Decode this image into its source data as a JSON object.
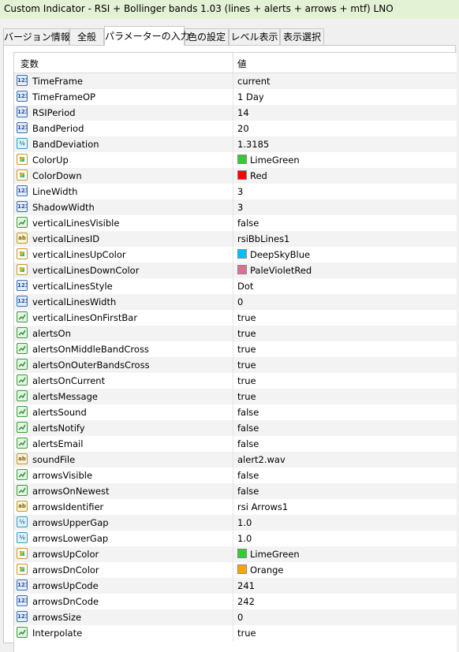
{
  "window": {
    "title": "Custom Indicator - RSI + Bollinger bands 1.03 (lines + alerts + arrows + mtf) LNO"
  },
  "tabs": [
    {
      "label": "バージョン情報",
      "active": false
    },
    {
      "label": "全般",
      "active": false
    },
    {
      "label": "パラメーターの入力",
      "active": true
    },
    {
      "label": "色の設定",
      "active": false
    },
    {
      "label": "レベル表示",
      "active": false
    },
    {
      "label": "表示選択",
      "active": false
    }
  ],
  "grid": {
    "headers": {
      "variable": "変数",
      "value": "値"
    },
    "rows": [
      {
        "name": "TimeFrame",
        "value": "current",
        "type": "int"
      },
      {
        "name": "TimeFrameOP",
        "value": "1 Day",
        "type": "int"
      },
      {
        "name": "RSIPeriod",
        "value": "14",
        "type": "int"
      },
      {
        "name": "BandPeriod",
        "value": "20",
        "type": "int"
      },
      {
        "name": "BandDeviation",
        "value": "1.3185",
        "type": "double"
      },
      {
        "name": "ColorUp",
        "value": "LimeGreen",
        "type": "color",
        "color": "#32cd32"
      },
      {
        "name": "ColorDown",
        "value": "Red",
        "type": "color",
        "color": "#ff0000"
      },
      {
        "name": "LineWidth",
        "value": "3",
        "type": "int"
      },
      {
        "name": "ShadowWidth",
        "value": "3",
        "type": "int"
      },
      {
        "name": "verticalLinesVisible",
        "value": "false",
        "type": "bool"
      },
      {
        "name": "verticalLinesID",
        "value": "rsiBbLines1",
        "type": "string"
      },
      {
        "name": "verticalLinesUpColor",
        "value": "DeepSkyBlue",
        "type": "color",
        "color": "#00bfff"
      },
      {
        "name": "verticalLinesDownColor",
        "value": "PaleVioletRed",
        "type": "color",
        "color": "#db7093"
      },
      {
        "name": "verticalLinesStyle",
        "value": "Dot",
        "type": "int"
      },
      {
        "name": "verticalLinesWidth",
        "value": "0",
        "type": "int"
      },
      {
        "name": "verticalLinesOnFirstBar",
        "value": "true",
        "type": "bool"
      },
      {
        "name": "alertsOn",
        "value": "true",
        "type": "bool"
      },
      {
        "name": "alertsOnMiddleBandCross",
        "value": "true",
        "type": "bool"
      },
      {
        "name": "alertsOnOuterBandsCross",
        "value": "true",
        "type": "bool"
      },
      {
        "name": "alertsOnCurrent",
        "value": "true",
        "type": "bool"
      },
      {
        "name": "alertsMessage",
        "value": "true",
        "type": "bool"
      },
      {
        "name": "alertsSound",
        "value": "false",
        "type": "bool"
      },
      {
        "name": "alertsNotify",
        "value": "false",
        "type": "bool"
      },
      {
        "name": "alertsEmail",
        "value": "false",
        "type": "bool"
      },
      {
        "name": "soundFile",
        "value": "alert2.wav",
        "type": "string"
      },
      {
        "name": "arrowsVisible",
        "value": "false",
        "type": "bool"
      },
      {
        "name": "arrowsOnNewest",
        "value": "false",
        "type": "bool"
      },
      {
        "name": "arrowsIdentifier",
        "value": "rsi Arrows1",
        "type": "string"
      },
      {
        "name": "arrowsUpperGap",
        "value": "1.0",
        "type": "double"
      },
      {
        "name": "arrowsLowerGap",
        "value": "1.0",
        "type": "double"
      },
      {
        "name": "arrowsUpColor",
        "value": "LimeGreen",
        "type": "color",
        "color": "#32cd32"
      },
      {
        "name": "arrowsDnColor",
        "value": "Orange",
        "type": "color",
        "color": "#ffa500"
      },
      {
        "name": "arrowsUpCode",
        "value": "241",
        "type": "int"
      },
      {
        "name": "arrowsDnCode",
        "value": "242",
        "type": "int"
      },
      {
        "name": "arrowsSize",
        "value": "0",
        "type": "int"
      },
      {
        "name": "Interpolate",
        "value": "true",
        "type": "bool"
      }
    ]
  }
}
